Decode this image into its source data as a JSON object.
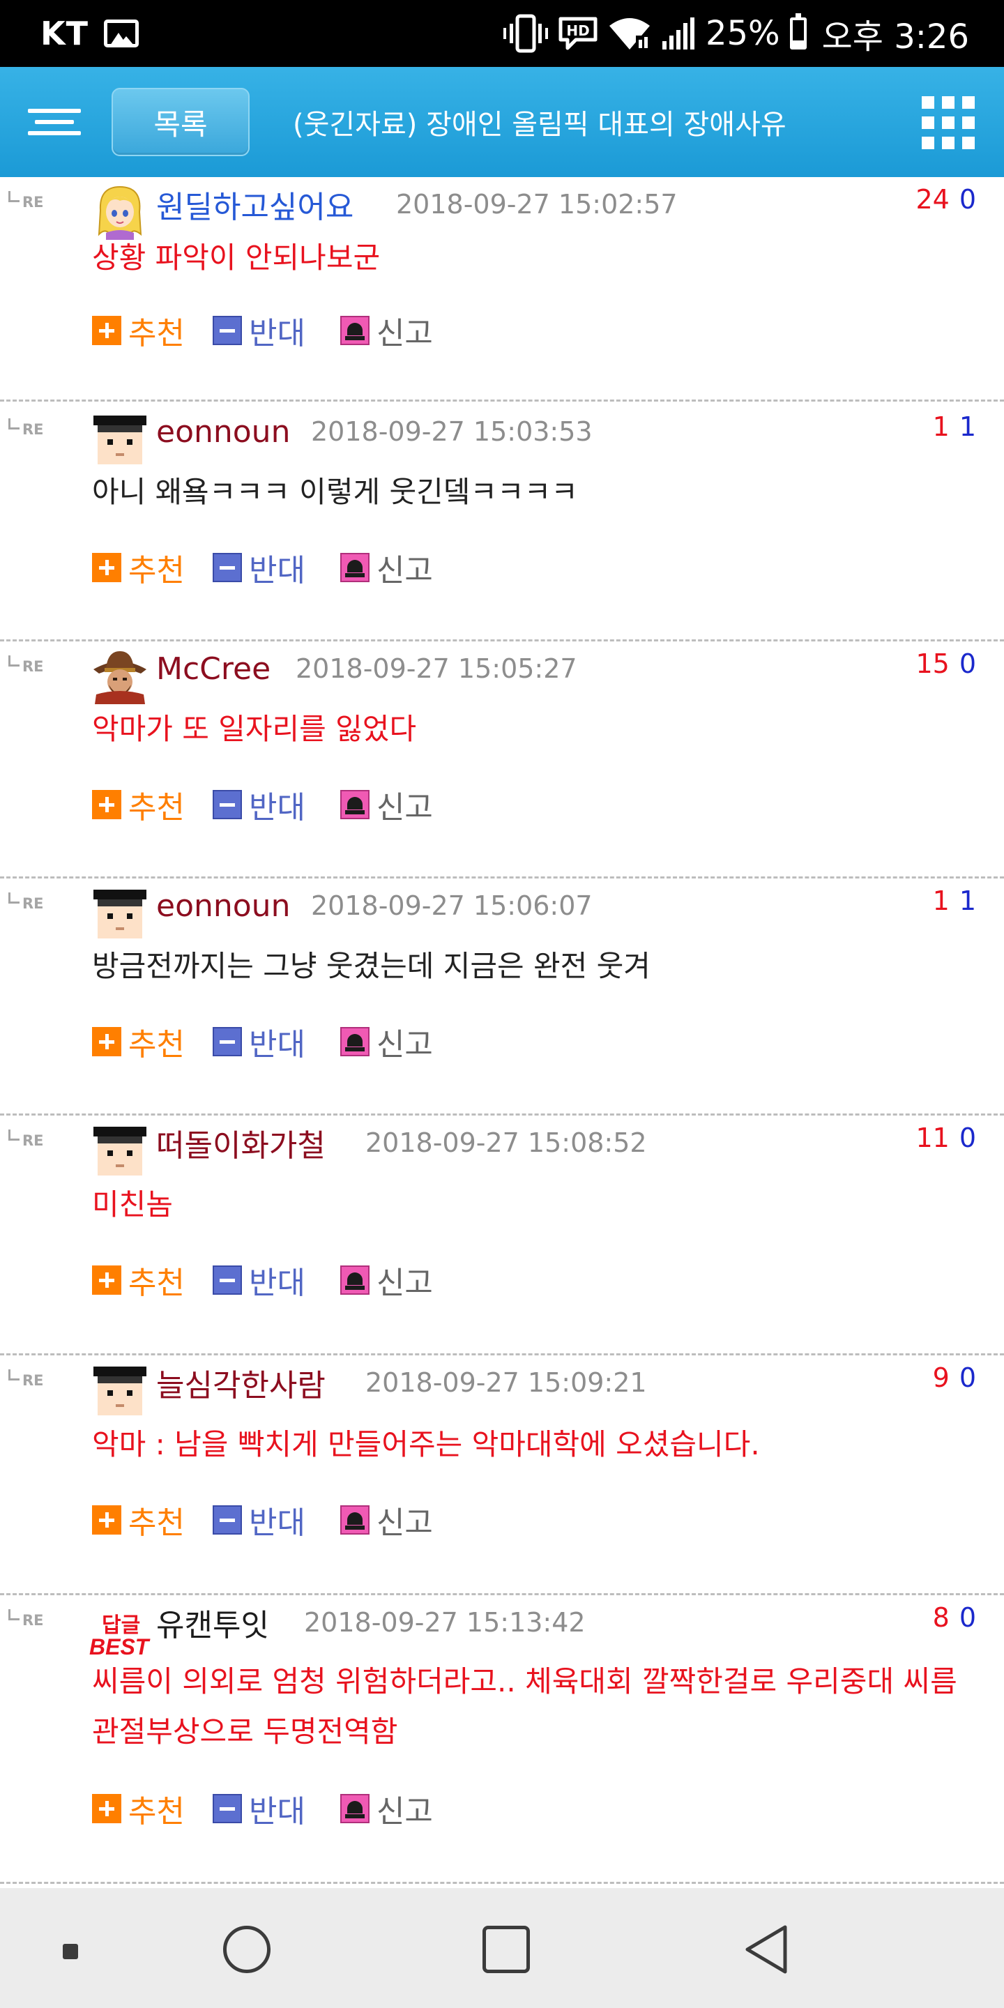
{
  "status_bar": {
    "carrier": "KT",
    "gallery_icon": "image-icon",
    "icons": [
      "vibrate-icon",
      "hd-voice-icon",
      "wifi-icon",
      "signal-icon"
    ],
    "battery_percent": "25%",
    "battery_level": 0.25,
    "time": "오후 3:26"
  },
  "header": {
    "menu_icon": "menu-icon",
    "list_button": "목록",
    "title": "(웃긴자료) 장애인 올림픽 대표의 장애사유",
    "grid_icon": "apps-grid-icon",
    "background_color": "#1b9ad6"
  },
  "labels": {
    "re": "RE",
    "recommend": "추천",
    "oppose": "반대",
    "report": "신고"
  },
  "comments": [
    {
      "avatar": "blonde-girl-avatar",
      "author": "원딜하고싶어요",
      "author_color": "blue",
      "timestamp": "2018-09-27 15:02:57",
      "up": "24",
      "down": "0",
      "text": "상황 파악이 안되나보군",
      "text_color": "red"
    },
    {
      "avatar": "graduate-avatar",
      "author": "eonnoun",
      "author_color": "maroon",
      "timestamp": "2018-09-27 15:03:53",
      "up": "1",
      "down": "1",
      "text": "아니 왜욬ㅋㅋㅋ 이렇게 웃긴뎈ㅋㅋㅋㅋ",
      "text_color": "dark"
    },
    {
      "avatar": "mccree-avatar",
      "author": "McCree",
      "author_color": "maroon",
      "timestamp": "2018-09-27 15:05:27",
      "up": "15",
      "down": "0",
      "text": "악마가 또 일자리를 잃었다",
      "text_color": "red"
    },
    {
      "avatar": "graduate-avatar",
      "author": "eonnoun",
      "author_color": "maroon",
      "timestamp": "2018-09-27 15:06:07",
      "up": "1",
      "down": "1",
      "text": "방금전까지는 그냥 웃겼는데 지금은 완전 웃겨",
      "text_color": "dark"
    },
    {
      "avatar": "graduate-avatar",
      "author": "떠돌이화가철",
      "author_color": "maroon",
      "timestamp": "2018-09-27 15:08:52",
      "up": "11",
      "down": "0",
      "text": "미친놈",
      "text_color": "red"
    },
    {
      "avatar": "graduate-avatar",
      "author": "늘심각한사람",
      "author_color": "maroon",
      "timestamp": "2018-09-27 15:09:21",
      "up": "9",
      "down": "0",
      "text": "악마 : 남을 빡치게 만들어주는 악마대학에 오셨습니다.",
      "text_color": "red"
    },
    {
      "avatar": "best-reply-badge",
      "badge_line1": "답글",
      "badge_line2": "BEST",
      "author": "유캔투잇",
      "author_color": "black",
      "timestamp": "2018-09-27 15:13:42",
      "up": "8",
      "down": "0",
      "text": "씨름이 의외로 엄청 위험하더라고.. 체육대회 깔짝한걸로 우리중대 씨름 관절부상으로 두명전역함",
      "text_color": "red"
    }
  ],
  "nav_bar": {
    "buttons": [
      "dot-icon",
      "home-icon",
      "recent-apps-icon",
      "back-icon"
    ]
  }
}
